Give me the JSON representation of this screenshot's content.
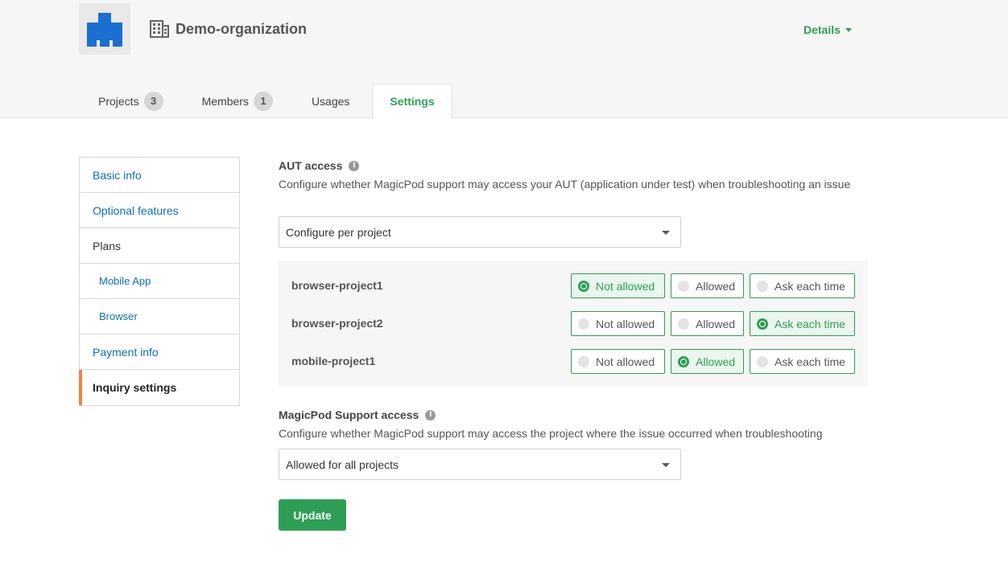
{
  "header": {
    "org_name": "Demo-organization",
    "details_label": "Details",
    "org_icon": "building-icon",
    "logo": "magicpod-logo"
  },
  "tabs": [
    {
      "label": "Projects",
      "badge": "3"
    },
    {
      "label": "Members",
      "badge": "1"
    },
    {
      "label": "Usages"
    },
    {
      "label": "Settings",
      "active": true
    }
  ],
  "sidebar": {
    "items": [
      {
        "label": "Basic info"
      },
      {
        "label": "Optional features"
      },
      {
        "label": "Plans"
      },
      {
        "label": "Mobile App"
      },
      {
        "label": "Browser"
      },
      {
        "label": "Payment info"
      },
      {
        "label": "Inquiry settings",
        "active": true
      }
    ]
  },
  "aut_access": {
    "title": "AUT access",
    "description": "Configure whether MagicPod support may access your AUT (application under test) when troubleshooting an issue",
    "select_value": "Configure per project",
    "options": [
      "Not allowed",
      "Allowed",
      "Ask each time"
    ],
    "projects": [
      {
        "name": "browser-project1",
        "selected": "Not allowed"
      },
      {
        "name": "browser-project2",
        "selected": "Ask each time"
      },
      {
        "name": "mobile-project1",
        "selected": "Allowed"
      }
    ]
  },
  "support_access": {
    "title": "MagicPod Support access",
    "description": "Configure whether MagicPod support may access the project where the issue occurred when troubleshooting",
    "select_value": "Allowed for all projects"
  },
  "update_label": "Update",
  "colors": {
    "accent_green": "#2e9e55",
    "link_blue": "#0b6fb3",
    "active_marker_orange": "#f0843c",
    "logo_blue": "#1a6fd1"
  }
}
